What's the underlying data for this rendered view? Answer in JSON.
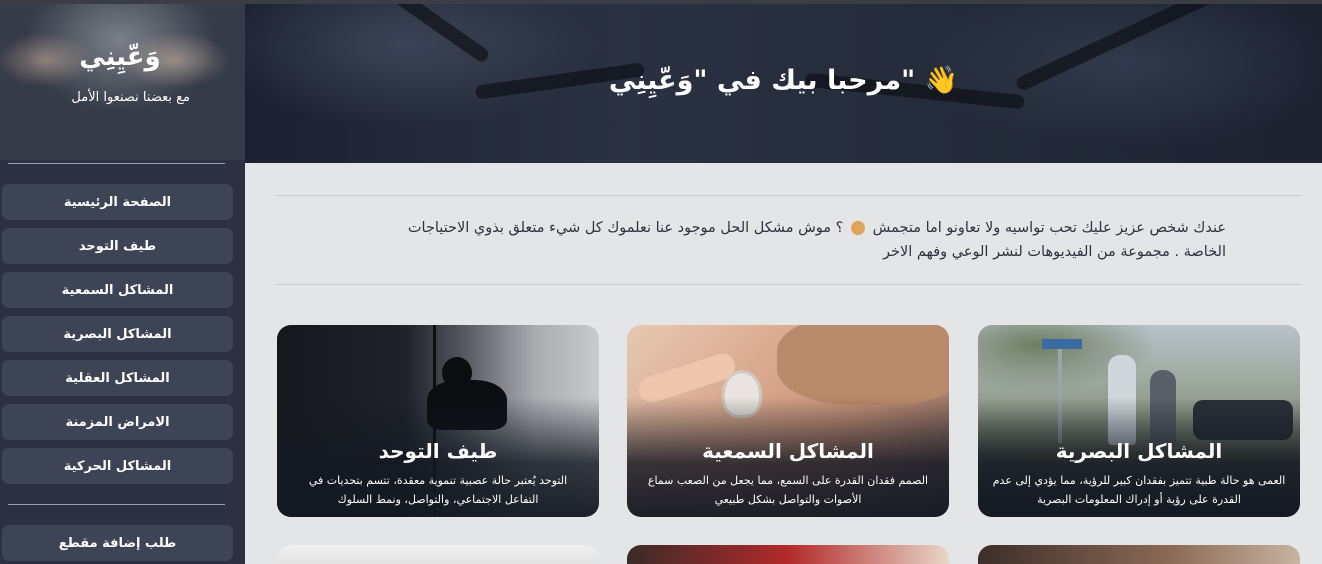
{
  "brand": {
    "logo_text": "وَعّيِنِي",
    "tagline": "مع بعضنا نصنعوا الأمل"
  },
  "sidebar": {
    "items": [
      {
        "label": "الصفحة الرئيسية"
      },
      {
        "label": "طيف التوحد"
      },
      {
        "label": "المشاكل السمعية"
      },
      {
        "label": "المشاكل البصرية"
      },
      {
        "label": "المشاكل العقلية"
      },
      {
        "label": "الامراض المزمنة"
      },
      {
        "label": "المشاكل الحركية"
      }
    ],
    "request_button": "طلب إضافة مقطع"
  },
  "hero": {
    "title": "مرحبا بيك في \"وَعّيِنِي\" 👋"
  },
  "intro": {
    "line1_part1": "عندك شخص عزيز عليك تحب تواسيه ولا تعاونو اما متجمش",
    "heart_icon": "handshake-heart-icon",
    "line1_part2": "؟ موش مشكل الحل موجود عنا نعلموك كل شيء متعلق بذوي الاحتياجات",
    "line2": "الخاصة . مجموعة من الفيديوهات لنشر الوعي وفهم الاخر"
  },
  "cards": [
    {
      "title": "المشاكل البصرية",
      "description": "العمى هو حالة طبية تتميز بفقدان كبير للرؤية، مما يؤدي إلى عدم القدرة على رؤية أو إدراك المعلومات البصرية",
      "image": "street-walkers-photo"
    },
    {
      "title": "المشاكل السمعية",
      "description": "الصمم فقدان القدرة على السمع، مما يجعل من الصعب سماع الأصوات والتواصل بشكل طبيعي",
      "image": "hearing-aid-child-photo"
    },
    {
      "title": "طيف التوحد",
      "description": "التوحد يُعتبر حالة عصبية تنموية معقدة، تتسم بتحديات في التفاعل الاجتماعي، والتواصل، ونمط السلوك",
      "image": "sitting-alone-silhouette-photo"
    }
  ]
}
